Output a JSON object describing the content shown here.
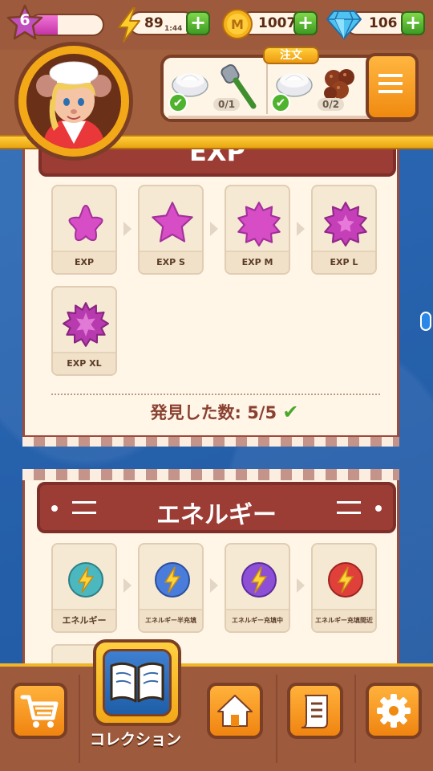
{
  "hud": {
    "level": "6",
    "level_progress": 0.38,
    "energy": "89",
    "energy_timer": "1:44",
    "coins": "1007",
    "gems": "106"
  },
  "order": {
    "tag": "注文",
    "items": [
      {
        "count": "0/1",
        "done": true
      },
      {
        "count": "0/2",
        "done": true
      }
    ]
  },
  "exp_section": {
    "title": "EXP",
    "tiles": [
      {
        "label": "EXP",
        "icon": "star-icon"
      },
      {
        "label": "EXP S",
        "icon": "star-icon"
      },
      {
        "label": "EXP M",
        "icon": "star-icon"
      },
      {
        "label": "EXP L",
        "icon": "star-icon"
      },
      {
        "label": "EXP XL",
        "icon": "star-icon"
      }
    ],
    "found_label": "発見した数: 5/5"
  },
  "energy_section": {
    "title": "エネルギー",
    "tiles": [
      {
        "label": "エネルギー"
      },
      {
        "label": "エネルギー半充填"
      },
      {
        "label": "エネルギー充填中"
      },
      {
        "label": "エネルギー充填間近"
      }
    ]
  },
  "nav": {
    "collection_label": "コレクション"
  },
  "colors": {
    "wood": "#9d5a3d",
    "banner": "#9b3c35",
    "gold": "#f2a818",
    "card": "#fff6e8",
    "green": "#4fb32e"
  }
}
